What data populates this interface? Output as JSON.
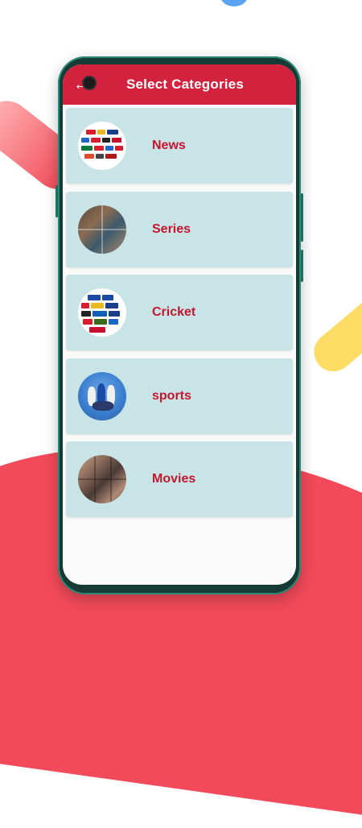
{
  "appbar": {
    "title": "Select Categories",
    "back_icon": "arrow-left-icon",
    "color": "#d3223d"
  },
  "categories": [
    {
      "label": "News",
      "thumb": "news-channels-collage"
    },
    {
      "label": "Series",
      "thumb": "series-collage"
    },
    {
      "label": "Cricket",
      "thumb": "cricket-channels-collage"
    },
    {
      "label": "sports",
      "thumb": "sports-team-photo"
    },
    {
      "label": "Movies",
      "thumb": "movies-collage"
    }
  ],
  "colors": {
    "card_bg": "#c9e4e6",
    "label": "#c4162f",
    "background_blob": "#f24a5a",
    "accent_yellow": "#ffdc66"
  }
}
